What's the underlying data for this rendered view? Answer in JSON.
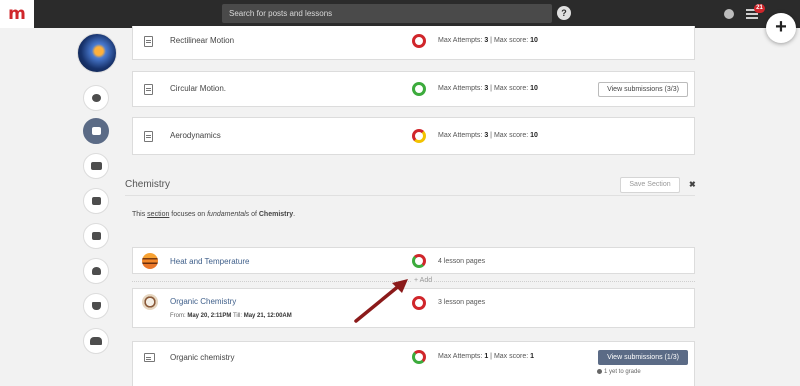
{
  "topbar": {
    "logo": "m",
    "search_placeholder": "Search for posts and lessons",
    "help": "?",
    "notifications_count": "21"
  },
  "fab": {
    "label": "+"
  },
  "lessons_top": [
    {
      "title": "Rectilinear Motion",
      "ring": "red",
      "attempts": "3",
      "max_score": "10"
    },
    {
      "title": "Circular Motion.",
      "ring": "green",
      "attempts": "3",
      "max_score": "10",
      "button": "View submissions (3/3)"
    },
    {
      "title": "Aerodynamics",
      "ring": "mixed",
      "attempts": "3",
      "max_score": "10"
    }
  ],
  "labels": {
    "max_attempts": "Max Attempts:",
    "max_score": "Max score:",
    "separator": "|",
    "from": "From:",
    "till": "Till:"
  },
  "section": {
    "title": "Chemistry",
    "save": "Save Section",
    "close": "✖",
    "desc_1": "This ",
    "desc_section": "section",
    "desc_2": " focuses on ",
    "desc_fund": "fundamentals",
    "desc_3": " of ",
    "desc_chem": "Chemistry",
    "desc_4": "."
  },
  "chem_lessons": {
    "heat": {
      "title": "Heat and Temperature",
      "pages": "4 lesson pages"
    },
    "organic": {
      "title": "Organic Chemistry",
      "pages": "3 lesson pages",
      "from": "May 20, 2:11PM",
      "till": "May 21, 12:00AM"
    },
    "organic2": {
      "title": "Organic chemistry",
      "attempts": "1",
      "max_score": "1",
      "button": "View submissions (1/3)",
      "grade": "1 yet to grade"
    }
  },
  "add_label": "+ Add",
  "colors": {
    "accent": "#5b6b86",
    "brand": "#d0262b",
    "green": "#3cab3c"
  }
}
